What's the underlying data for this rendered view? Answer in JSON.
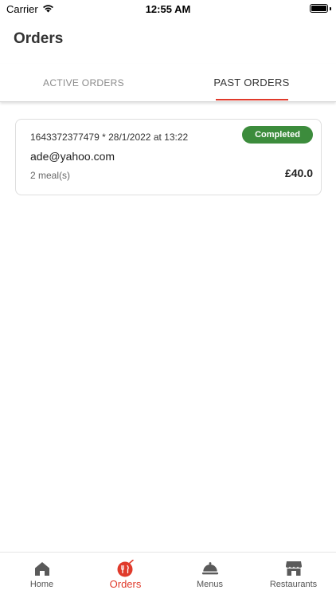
{
  "status_bar": {
    "carrier": "Carrier",
    "time": "12:55 AM",
    "icons": [
      "wifi-icon",
      "battery-icon"
    ]
  },
  "header": {
    "title": "Orders"
  },
  "tabs": [
    {
      "label": "ACTIVE ORDERS",
      "active": false
    },
    {
      "label": "PAST ORDERS",
      "active": true
    }
  ],
  "orders": [
    {
      "meta": "1643372377479 * 28/1/2022 at 13:22",
      "status": "Completed",
      "email": "ade@yahoo.com",
      "meals": "2 meal(s)",
      "total": "£40.0"
    }
  ],
  "bottom_nav": [
    {
      "label": "Home",
      "icon": "home-icon",
      "active": false
    },
    {
      "label": "Orders",
      "icon": "orders-icon",
      "active": true
    },
    {
      "label": "Menus",
      "icon": "cloche-icon",
      "active": false
    },
    {
      "label": "Restaurants",
      "icon": "storefront-icon",
      "active": false
    }
  ],
  "colors": {
    "accent": "#e03a2b",
    "status_completed": "#3c8c3c",
    "nav_icon": "#555555"
  }
}
